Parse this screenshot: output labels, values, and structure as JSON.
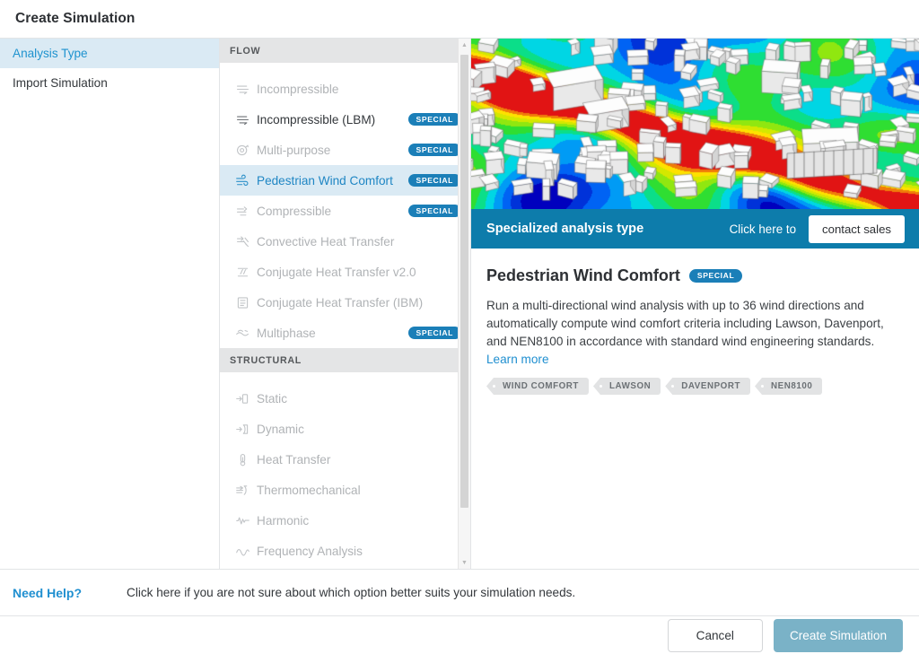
{
  "window": {
    "title": "Create Simulation"
  },
  "sidebar": {
    "items": [
      {
        "label": "Analysis Type",
        "active": true
      },
      {
        "label": "Import Simulation",
        "active": false
      }
    ]
  },
  "list": {
    "groups": [
      {
        "header": "FLOW",
        "items": [
          {
            "label": "Incompressible",
            "icon": "flow-lines-icon",
            "badge": "",
            "state": "disabled"
          },
          {
            "label": "Incompressible (LBM)",
            "icon": "flow-lines-icon",
            "badge": "SPECIAL",
            "state": "enabled"
          },
          {
            "label": "Multi-purpose",
            "icon": "multipurpose-icon",
            "badge": "SPECIAL",
            "state": "disabled"
          },
          {
            "label": "Pedestrian Wind Comfort",
            "icon": "wind-icon",
            "badge": "SPECIAL",
            "state": "selected"
          },
          {
            "label": "Compressible",
            "icon": "compressible-icon",
            "badge": "SPECIAL",
            "state": "disabled"
          },
          {
            "label": "Convective Heat Transfer",
            "icon": "convective-heat-icon",
            "badge": "",
            "state": "disabled"
          },
          {
            "label": "Conjugate Heat Transfer v2.0",
            "icon": "conjugate-heat-icon",
            "badge": "",
            "state": "disabled"
          },
          {
            "label": "Conjugate Heat Transfer (IBM)",
            "icon": "conjugate-ibm-icon",
            "badge": "",
            "state": "disabled"
          },
          {
            "label": "Multiphase",
            "icon": "multiphase-icon",
            "badge": "SPECIAL",
            "state": "disabled"
          }
        ]
      },
      {
        "header": "STRUCTURAL",
        "items": [
          {
            "label": "Static",
            "icon": "static-icon",
            "badge": "",
            "state": "disabled"
          },
          {
            "label": "Dynamic",
            "icon": "dynamic-icon",
            "badge": "",
            "state": "disabled"
          },
          {
            "label": "Heat Transfer",
            "icon": "thermometer-icon",
            "badge": "",
            "state": "disabled"
          },
          {
            "label": "Thermomechanical",
            "icon": "thermomechanical-icon",
            "badge": "",
            "state": "disabled"
          },
          {
            "label": "Harmonic",
            "icon": "harmonic-icon",
            "badge": "",
            "state": "disabled"
          },
          {
            "label": "Frequency Analysis",
            "icon": "frequency-icon",
            "badge": "",
            "state": "disabled"
          }
        ]
      }
    ],
    "scrollbar": {
      "up": "▲",
      "down": "▼"
    }
  },
  "detail": {
    "banner": {
      "title": "Specialized analysis type",
      "note": "Click here to",
      "button": "contact sales"
    },
    "title": "Pedestrian Wind Comfort",
    "badge": "SPECIAL",
    "description": "Run a multi-directional wind analysis with up to 36 wind directions and automatically compute wind comfort criteria including Lawson, Davenport, and NEN8100 in accordance with standard wind engineering standards.",
    "learn_more": "Learn more",
    "tags": [
      "WIND COMFORT",
      "LAWSON",
      "DAVENPORT",
      "NEN8100"
    ]
  },
  "help": {
    "label": "Need Help?",
    "text": "Click here if you are not sure about which option better suits your simulation needs."
  },
  "footer": {
    "cancel": "Cancel",
    "submit": "Create Simulation"
  },
  "colors": {
    "accent": "#1f8fd0",
    "banner": "#0d7cab",
    "badge": "#1b7fb8",
    "selected_row": "#daeaf4",
    "primary_button": "#7ab2c7"
  }
}
